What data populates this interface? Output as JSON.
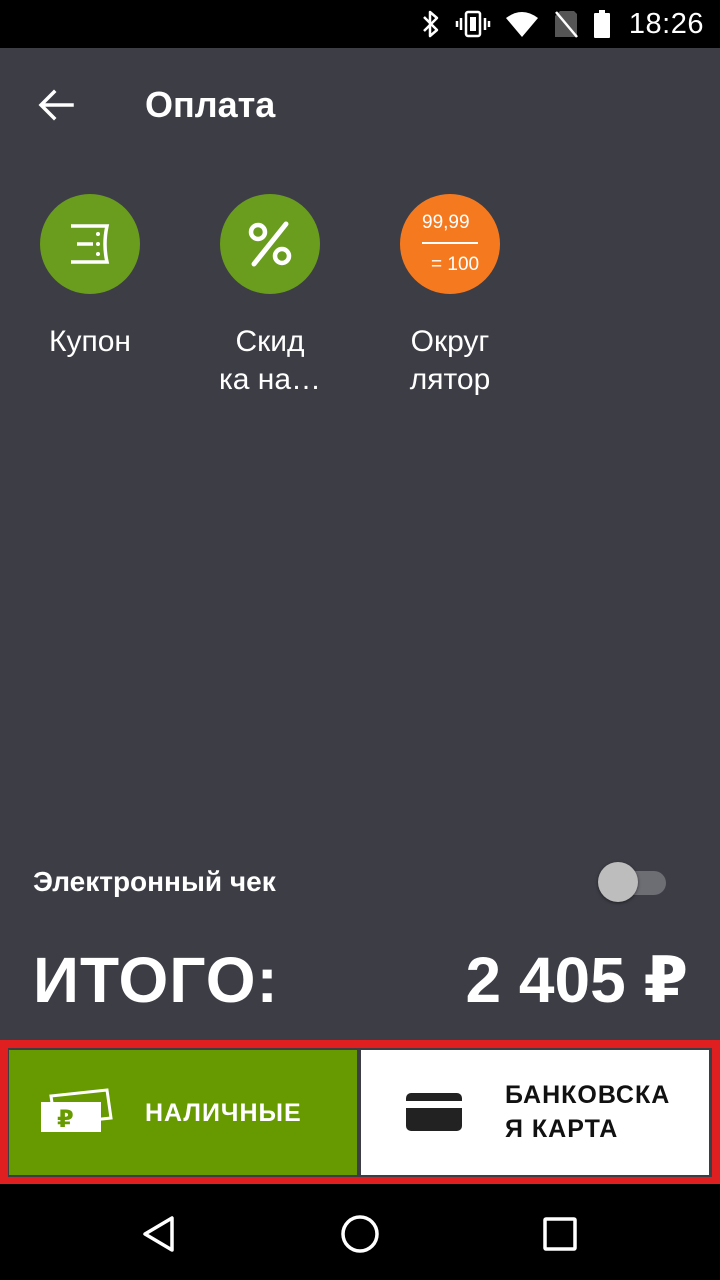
{
  "status_bar": {
    "time": "18:26",
    "icons": [
      "bluetooth-icon",
      "vibrate-icon",
      "wifi-icon",
      "no-sim-icon",
      "battery-icon"
    ]
  },
  "toolbar": {
    "back_icon": "arrow-left-icon",
    "title": "Оплата"
  },
  "actions": [
    {
      "label_line1": "Купон",
      "label_line2": "",
      "icon": "coupon-icon",
      "color": "#6a9c1e"
    },
    {
      "label_line1": "Скид",
      "label_line2": "ка на…",
      "icon": "percent-icon",
      "color": "#6a9c1e"
    },
    {
      "label_line1": "Округ",
      "label_line2": "лятор",
      "icon": "rounding-icon",
      "color": "#f57a1f",
      "icon_top": "99,99",
      "icon_bottom": "= 100"
    }
  ],
  "receipt": {
    "label": "Электронный чек",
    "enabled": false
  },
  "total": {
    "label": "ИТОГО:",
    "value": "2 405 ₽"
  },
  "payment": {
    "cash_label": "НАЛИЧНЫЕ",
    "card_label_line1": "БАНКОВСКА",
    "card_label_line2": "Я КАРТА",
    "cash_color": "#669a00",
    "card_color": "#ffffff",
    "highlight_color": "#e02020"
  },
  "nav": {
    "icons": [
      "back-triangle-icon",
      "home-circle-icon",
      "recents-square-icon"
    ]
  },
  "colors": {
    "background": "#3d3d46",
    "accent_green": "#6a9c1e",
    "accent_orange": "#f57a1f"
  }
}
